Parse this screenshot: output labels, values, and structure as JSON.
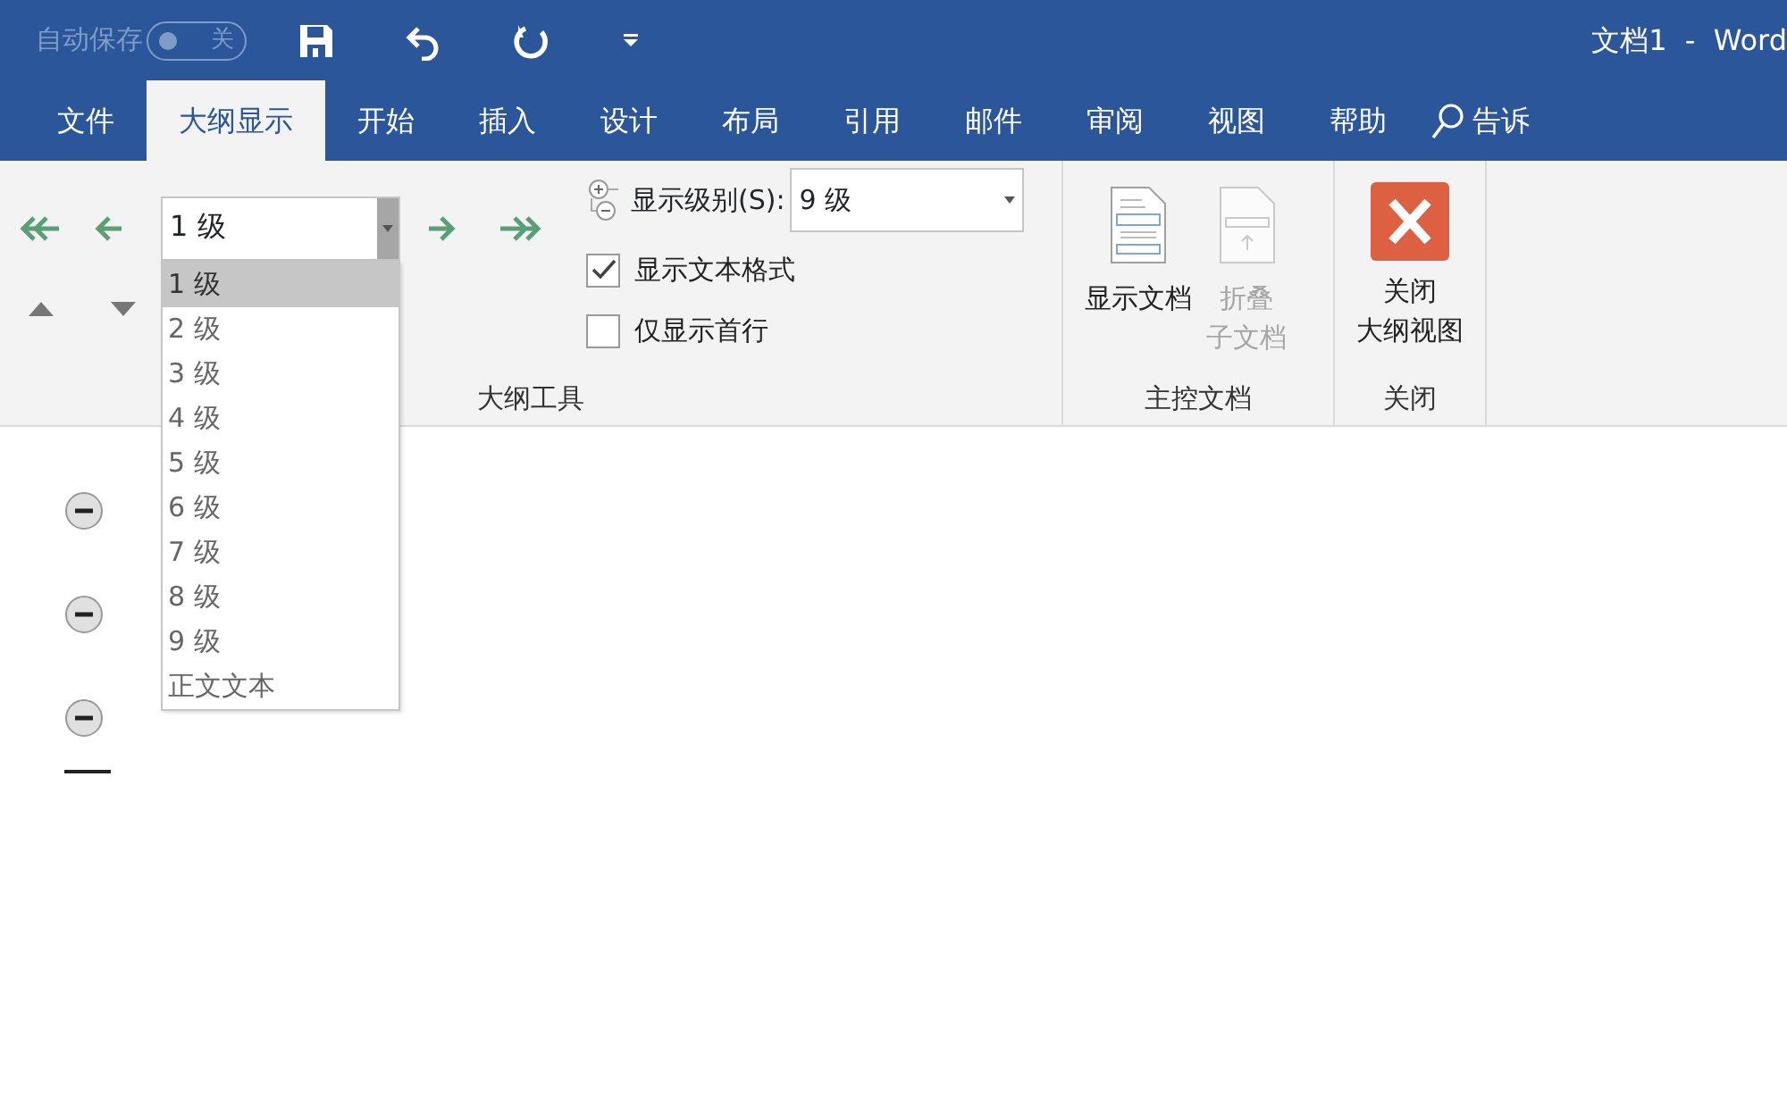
{
  "title_bar": {
    "autosave_label": "自动保存",
    "autosave_toggle": {
      "label": "关",
      "on": false
    },
    "title": "文档1  -  Word"
  },
  "tabs": [
    {
      "label": "文件",
      "selected": false
    },
    {
      "label": "大纲显示",
      "selected": true
    },
    {
      "label": "开始",
      "selected": false
    },
    {
      "label": "插入",
      "selected": false
    },
    {
      "label": "设计",
      "selected": false
    },
    {
      "label": "布局",
      "selected": false
    },
    {
      "label": "引用",
      "selected": false
    },
    {
      "label": "邮件",
      "selected": false
    },
    {
      "label": "审阅",
      "selected": false
    },
    {
      "label": "视图",
      "selected": false
    },
    {
      "label": "帮助",
      "selected": false
    }
  ],
  "tell_me": "告诉",
  "outline_tools": {
    "level_select": {
      "value": "1 级",
      "expanded": true,
      "options": [
        {
          "label": "1 级",
          "selected": true
        },
        {
          "label": "2 级",
          "selected": false
        },
        {
          "label": "3 级",
          "selected": false
        },
        {
          "label": "4 级",
          "selected": false
        },
        {
          "label": "5 级",
          "selected": false
        },
        {
          "label": "6 级",
          "selected": false
        },
        {
          "label": "7 级",
          "selected": false
        },
        {
          "label": "8 级",
          "selected": false
        },
        {
          "label": "9 级",
          "selected": false
        },
        {
          "label": "正文文本",
          "selected": false
        }
      ]
    },
    "show_level": {
      "label": "显示级别(S):",
      "value": "9 级"
    },
    "checkboxes": [
      {
        "label": "显示文本格式",
        "checked": true
      },
      {
        "label": "仅显示首行",
        "checked": false
      }
    ],
    "group_label": "大纲工具"
  },
  "master_document": {
    "buttons": [
      {
        "label_lines": [
          "显示文档"
        ],
        "disabled": false
      },
      {
        "label_lines": [
          "折叠",
          "子文档"
        ],
        "disabled": true
      }
    ],
    "group_label": "主控文档"
  },
  "close": {
    "button_lines": [
      "关闭",
      "大纲视图"
    ],
    "group_label": "关闭"
  },
  "document": {
    "headings": [
      {
        "expanded": true
      },
      {
        "expanded": true
      },
      {
        "expanded": true
      }
    ]
  }
}
